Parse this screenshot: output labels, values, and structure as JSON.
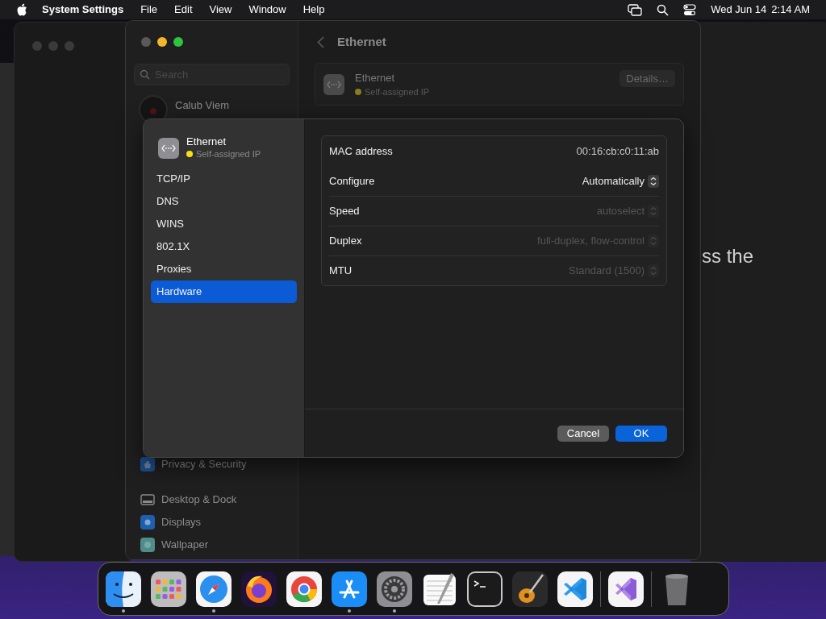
{
  "menu_bar": {
    "app": "System Settings",
    "menus": [
      "File",
      "Edit",
      "View",
      "Window",
      "Help"
    ],
    "date": "Wed Jun 14",
    "time": "2:14 AM"
  },
  "background_window": {
    "text": "ss the"
  },
  "settings": {
    "search": {
      "placeholder": "Search"
    },
    "account": {
      "name": "Calub Viem"
    },
    "sidebar_sections": [
      {
        "items": [
          {
            "label": "Privacy & Security",
            "kind": "privacy"
          }
        ]
      },
      {
        "items": [
          {
            "label": "Desktop & Dock",
            "kind": "dock"
          },
          {
            "label": "Displays",
            "kind": "displays"
          },
          {
            "label": "Wallpaper",
            "kind": "wallpaper"
          }
        ]
      }
    ],
    "title": "Ethernet",
    "service": {
      "name": "Ethernet",
      "status": "Self-assigned IP",
      "color": "#8a7d1c",
      "action": "Details…"
    }
  },
  "sheet": {
    "service": {
      "name": "Ethernet",
      "status": "Self-assigned IP",
      "color": "#f2e21a"
    },
    "tabs": [
      {
        "label": "TCP/IP",
        "selected": false
      },
      {
        "label": "DNS",
        "selected": false
      },
      {
        "label": "WINS",
        "selected": false
      },
      {
        "label": "802.1X",
        "selected": false
      },
      {
        "label": "Proxies",
        "selected": false
      },
      {
        "label": "Hardware",
        "selected": true
      }
    ],
    "rows": [
      {
        "label": "MAC address",
        "value": "00:16:cb:c0:11:ab",
        "kind": "text",
        "disabled": false
      },
      {
        "label": "Configure",
        "value": "Automatically",
        "kind": "popup",
        "disabled": false
      },
      {
        "label": "Speed",
        "value": "autoselect",
        "kind": "popup",
        "disabled": true
      },
      {
        "label": "Duplex",
        "value": "full-duplex, flow-control",
        "kind": "popup",
        "disabled": true
      },
      {
        "label": "MTU",
        "value": "Standard (1500)",
        "kind": "popup",
        "disabled": true
      }
    ],
    "buttons": [
      {
        "label": "Cancel",
        "kind": "secondary"
      },
      {
        "label": "OK",
        "kind": "primary"
      }
    ]
  },
  "dock": {
    "sections": [
      {
        "apps": [
          {
            "kind": "finder",
            "running": true
          },
          {
            "kind": "launchpad",
            "running": false
          },
          {
            "kind": "safari",
            "running": true
          },
          {
            "kind": "firefox",
            "running": false
          },
          {
            "kind": "chrome",
            "running": false
          },
          {
            "kind": "appstore",
            "running": true
          },
          {
            "kind": "settings",
            "running": true
          },
          {
            "kind": "textedit",
            "running": false
          },
          {
            "kind": "terminal",
            "running": false
          },
          {
            "kind": "garageband",
            "running": false
          },
          {
            "kind": "vscode",
            "running": false
          }
        ]
      },
      {
        "apps": [
          {
            "kind": "visualstudio",
            "running": false
          }
        ]
      },
      {
        "apps": [
          {
            "kind": "trash",
            "running": false
          }
        ]
      }
    ]
  }
}
